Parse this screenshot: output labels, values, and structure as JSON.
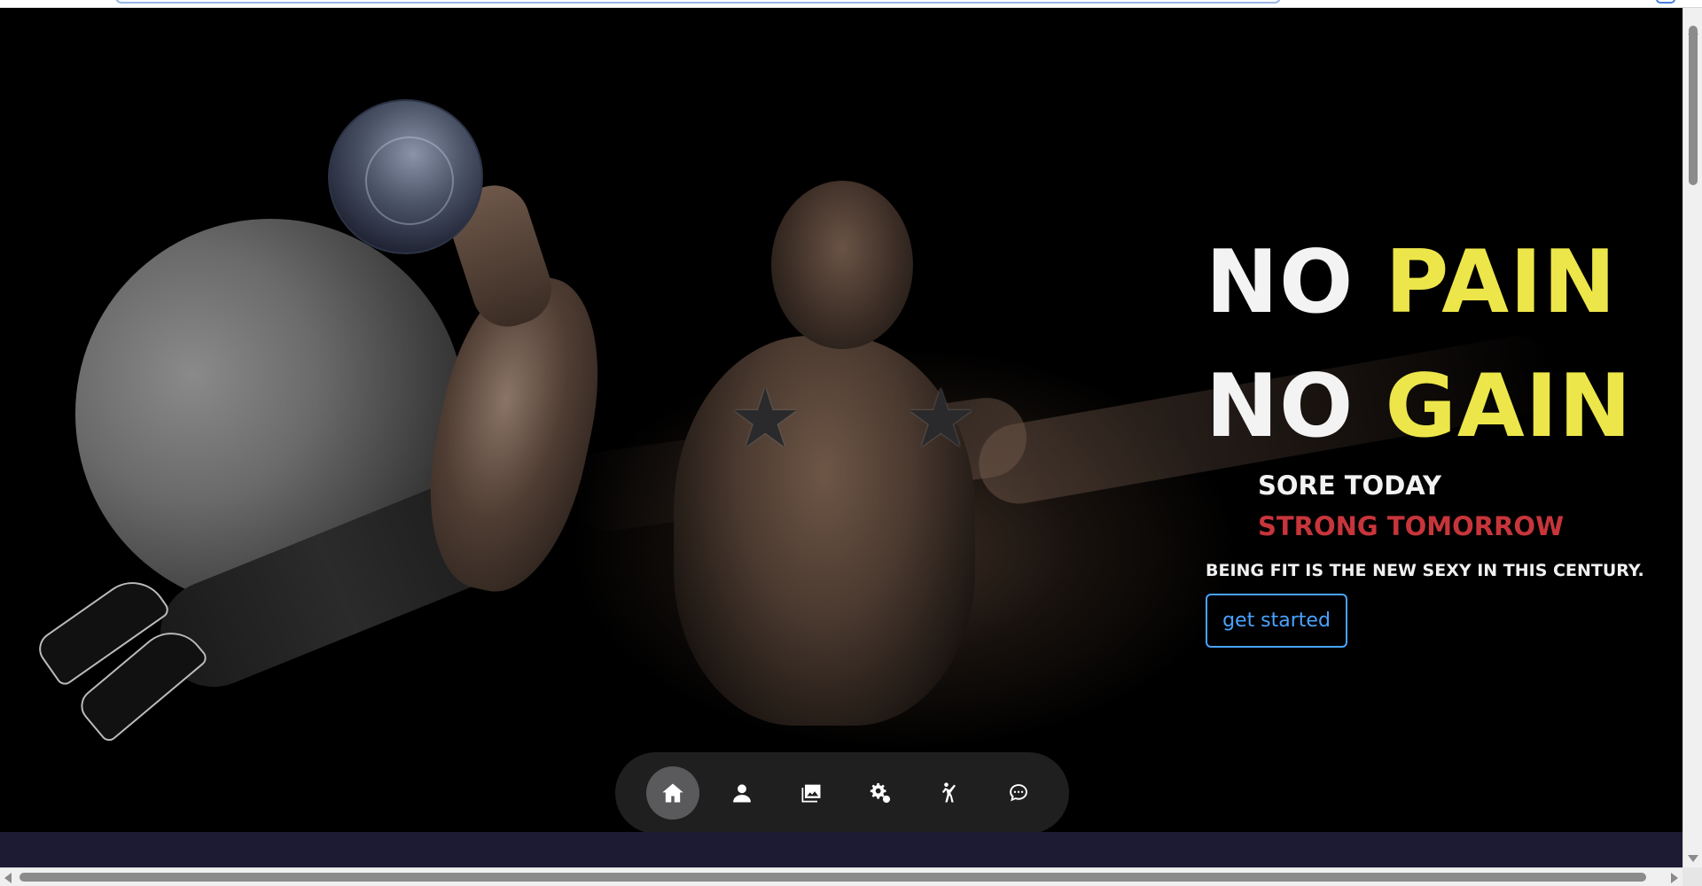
{
  "hero": {
    "headline_line1_white": "NO",
    "headline_line1_yellow": "PAIN",
    "headline_line2_white": "NO",
    "headline_line2_yellow": "GAIN",
    "sub_line1": "SORE TODAY",
    "sub_line2": "STRONG TOMORROW",
    "tagline": "BEING FIT IS THE NEW SEXY IN THIS CENTURY.",
    "cta_label": "get started"
  },
  "nav": {
    "items": [
      {
        "name": "home",
        "icon": "home-icon",
        "active": true
      },
      {
        "name": "profile",
        "icon": "user-icon",
        "active": false
      },
      {
        "name": "gallery",
        "icon": "image-gallery-icon",
        "active": false
      },
      {
        "name": "services",
        "icon": "gears-icon",
        "active": false
      },
      {
        "name": "training",
        "icon": "martial-arts-kick-icon",
        "active": false
      },
      {
        "name": "contact",
        "icon": "chat-bubble-icon",
        "active": false
      }
    ]
  },
  "colors": {
    "background": "#000000",
    "headline_white": "#f3f3f3",
    "headline_yellow": "#ece64a",
    "strong_tomorrow_red": "#c7353b",
    "cta_blue": "#4aa3ff",
    "nav_bg": "#1f1f20",
    "band_navy": "#1c1b33"
  }
}
